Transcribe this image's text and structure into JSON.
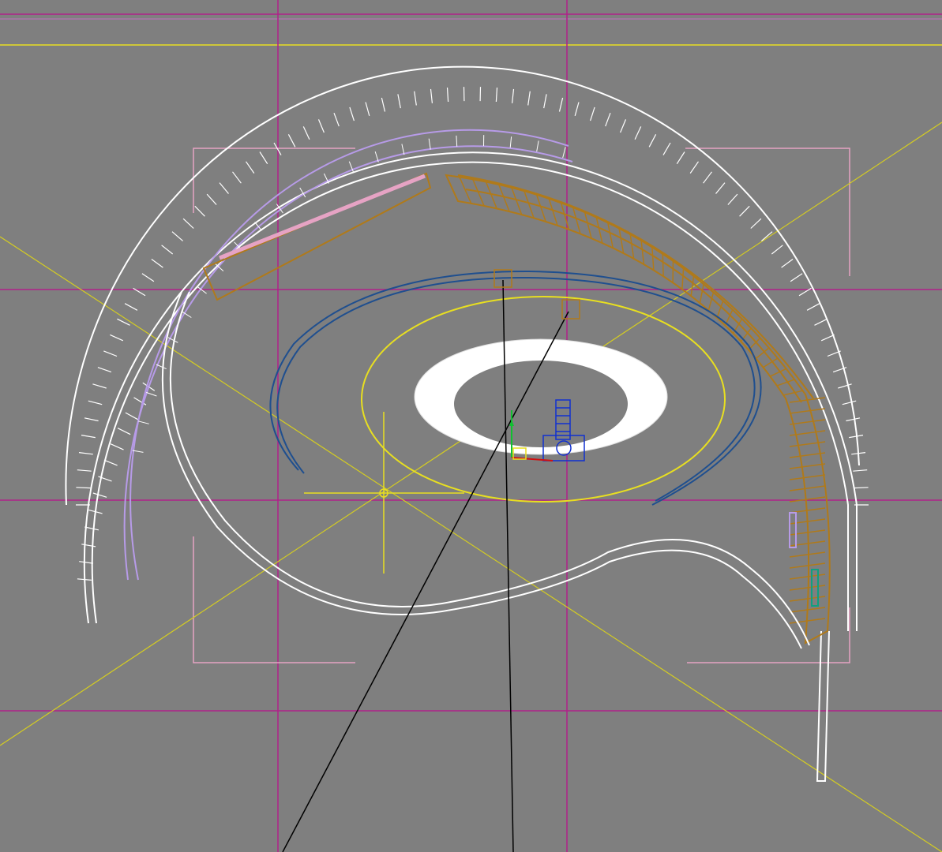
{
  "viewport": {
    "background": "#7f7f7f",
    "colors": {
      "wire_white": "#ffffff",
      "wire_orange": "#b07a1a",
      "wire_purple": "#b79be8",
      "wire_pink": "#e6a3c4",
      "wire_blue": "#1f4f8f",
      "wire_yellow": "#e8df20",
      "grid_magenta": "#b0208a",
      "light_lines": "#d4cc22",
      "camera_lines": "#000000",
      "gizmo_blue": "#1030d0",
      "gizmo_green": "#10c030",
      "gizmo_red": "#d01010",
      "teal_object": "#10a080"
    },
    "icons": [
      "light-crosshair-icon",
      "camera-target-icon",
      "transform-gizmo-icon"
    ]
  }
}
